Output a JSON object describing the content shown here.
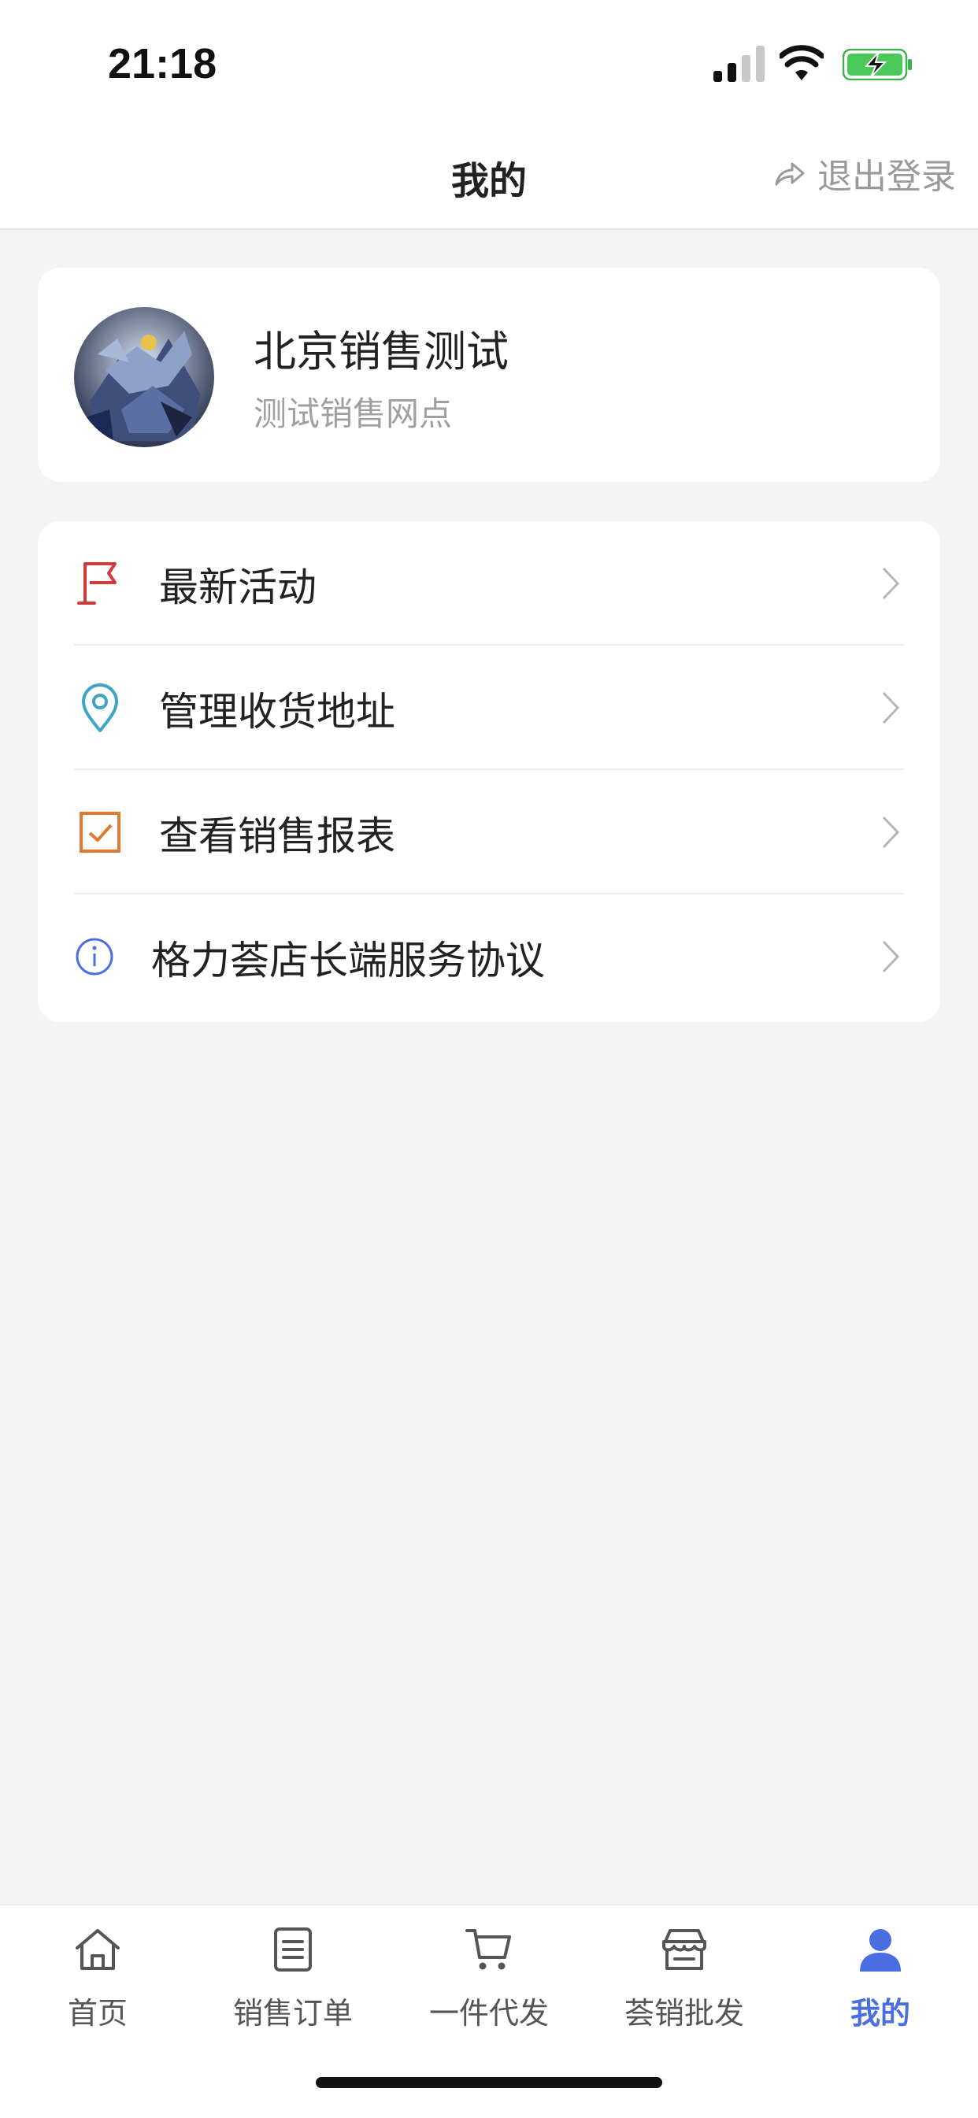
{
  "status_bar": {
    "time": "21:18"
  },
  "nav": {
    "title": "我的",
    "logout_label": "退出登录"
  },
  "profile": {
    "name": "北京销售测试",
    "subtitle": "测试销售网点"
  },
  "menu": [
    {
      "label": "最新活动",
      "icon": "flag-icon",
      "icon_color": "#d23b3b"
    },
    {
      "label": "管理收货地址",
      "icon": "location-pin-icon",
      "icon_color": "#3fa3c6"
    },
    {
      "label": "查看销售报表",
      "icon": "checkbox-icon",
      "icon_color": "#e07a2e"
    },
    {
      "label": "格力荟店长端服务协议",
      "icon": "info-icon",
      "icon_color": "#4a6ee0"
    }
  ],
  "tabs": [
    {
      "label": "首页",
      "icon": "home-icon",
      "active": false
    },
    {
      "label": "销售订单",
      "icon": "order-list-icon",
      "active": false
    },
    {
      "label": "一件代发",
      "icon": "cart-icon",
      "active": false
    },
    {
      "label": "荟销批发",
      "icon": "store-icon",
      "active": false
    },
    {
      "label": "我的",
      "icon": "user-icon",
      "active": true
    }
  ],
  "colors": {
    "accent": "#4a6ee0",
    "background": "#f4f4f4",
    "card": "#ffffff"
  }
}
